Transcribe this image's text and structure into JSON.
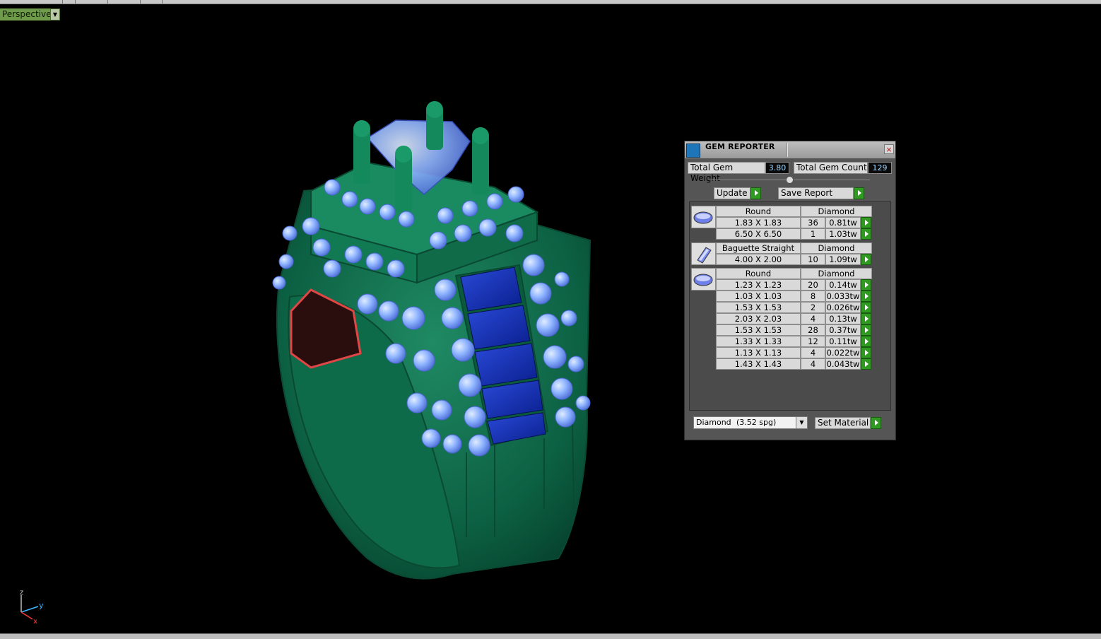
{
  "viewport": {
    "label": "Perspective",
    "axes": {
      "z": "z",
      "y": "y",
      "x": "x"
    }
  },
  "gem_reporter": {
    "title": "GEM REPORTER",
    "close_label": "×",
    "total_gem_weight_label": "Total Gem Weight",
    "total_gem_weight": "3.80",
    "total_gem_count_label": "Total Gem Count",
    "total_gem_count": "129",
    "update_label": "Update",
    "save_report_label": "Save Report",
    "groups": [
      {
        "shape": "Round",
        "material": "Diamond",
        "icon": "round-gem-icon",
        "rows": [
          {
            "size": "1.83 X 1.83",
            "count": "36",
            "weight": "0.81tw"
          },
          {
            "size": "6.50 X 6.50",
            "count": "1",
            "weight": "1.03tw"
          }
        ]
      },
      {
        "shape": "Baguette Straight",
        "material": "Diamond",
        "icon": "baguette-gem-icon",
        "rows": [
          {
            "size": "4.00 X 2.00",
            "count": "10",
            "weight": "1.09tw"
          }
        ]
      },
      {
        "shape": "Round",
        "material": "Diamond",
        "icon": "round-gem-icon",
        "rows": [
          {
            "size": "1.23 X 1.23",
            "count": "20",
            "weight": "0.14tw"
          },
          {
            "size": "1.03 X 1.03",
            "count": "8",
            "weight": "0.033tw"
          },
          {
            "size": "1.53 X 1.53",
            "count": "2",
            "weight": "0.026tw"
          },
          {
            "size": "2.03 X 2.03",
            "count": "4",
            "weight": "0.13tw"
          },
          {
            "size": "1.53 X 1.53",
            "count": "28",
            "weight": "0.37tw"
          },
          {
            "size": "1.33 X 1.33",
            "count": "12",
            "weight": "0.11tw"
          },
          {
            "size": "1.13 X 1.13",
            "count": "4",
            "weight": "0.022tw"
          },
          {
            "size": "1.43 X 1.43",
            "count": "4",
            "weight": "0.043tw"
          }
        ]
      }
    ],
    "material_select": {
      "name": "Diamond",
      "density": "(3.52 spg)"
    },
    "set_material_label": "Set Material"
  }
}
